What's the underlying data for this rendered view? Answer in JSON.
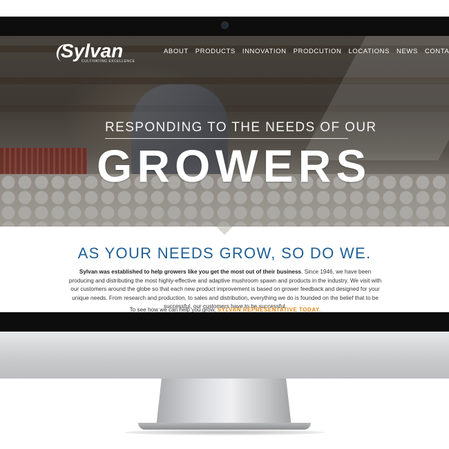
{
  "site": {
    "logo": "Sylvan",
    "tagline": "CULTIVATING EXCELLENCE"
  },
  "nav": {
    "items": [
      "ABOUT",
      "PRODUCTS",
      "INNOVATION",
      "PRODCUTION",
      "LOCATIONS",
      "NEWS",
      "CONTACT"
    ]
  },
  "hero": {
    "subtitle": "RESPONDING TO THE NEEDS OF OUR",
    "title": "GROWERS"
  },
  "content": {
    "heading": "AS YOUR NEEDS GROW, SO DO WE.",
    "intro_bold": "Sylvan was established to help growers like you get the most out of their business",
    "body": ". Since 1946, we have been producing and distributing the most highly-effective and adaptive mushroom spawn and products in the industry. We visit with our customers around the globe so that each new product improvement is based on grower feedback and designed for your unique needs. From research and production, to sales and distribution, everything we do is founded on the belief that to be successful, our customers have to be successful.",
    "cta_prefix": "To see how we can help you grow,",
    "cta_link": "SYLVAN REPRESENTATIVE TODAY."
  },
  "colors": {
    "heading": "#1f5f97",
    "link": "#e08a1e",
    "bezel": "#0d0d0d"
  }
}
